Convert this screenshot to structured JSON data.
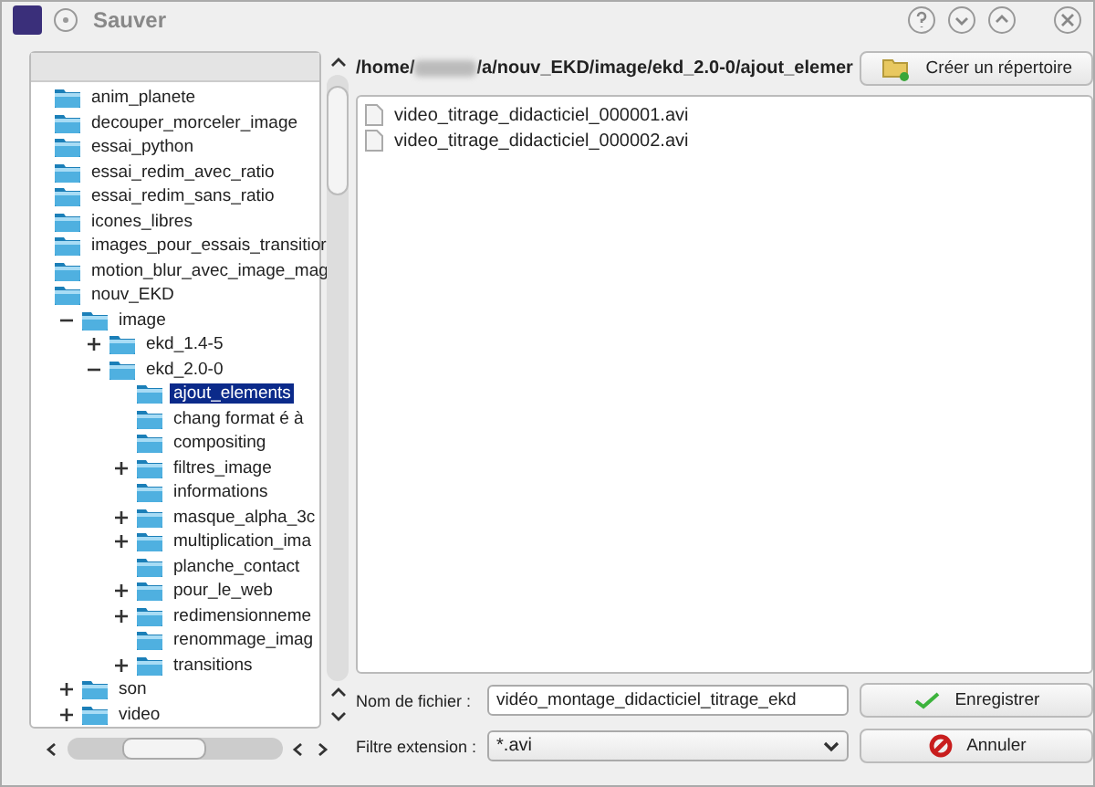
{
  "window": {
    "title": "Sauver"
  },
  "path": {
    "start": "/home/",
    "end": "/a/nouv_EKD/image/ekd_2.0-0/ajout_elemer"
  },
  "create_folder_button": "Créer un répertoire",
  "tree": [
    {
      "label": "anim_planete",
      "selected": false
    },
    {
      "label": "decouper_morceler_image",
      "selected": false
    },
    {
      "label": "essai_python",
      "selected": false
    },
    {
      "label": "essai_redim_avec_ratio",
      "selected": false
    },
    {
      "label": "essai_redim_sans_ratio",
      "selected": false
    },
    {
      "label": "icones_libres",
      "selected": false
    },
    {
      "label": "images_pour_essais_transitior",
      "selected": false
    },
    {
      "label": "motion_blur_avec_image_mag",
      "selected": false
    },
    {
      "label": "nouv_EKD",
      "selected": false,
      "children": [
        {
          "label": "image",
          "selected": false,
          "expanded": true,
          "children": [
            {
              "label": "ekd_1.4-5",
              "selected": false,
              "expanded": false
            },
            {
              "label": "ekd_2.0-0",
              "selected": false,
              "expanded": true,
              "children": [
                {
                  "label": "ajout_elements",
                  "selected": true
                },
                {
                  "label": "chang format é à",
                  "selected": false
                },
                {
                  "label": "compositing",
                  "selected": false
                },
                {
                  "label": "filtres_image",
                  "selected": false,
                  "expanded": false
                },
                {
                  "label": "informations",
                  "selected": false
                },
                {
                  "label": "masque_alpha_3c",
                  "selected": false,
                  "expanded": false
                },
                {
                  "label": "multiplication_ima",
                  "selected": false,
                  "expanded": false
                },
                {
                  "label": "planche_contact",
                  "selected": false
                },
                {
                  "label": "pour_le_web",
                  "selected": false,
                  "expanded": false
                },
                {
                  "label": "redimensionneme",
                  "selected": false,
                  "expanded": false
                },
                {
                  "label": "renommage_imag",
                  "selected": false
                },
                {
                  "label": "transitions",
                  "selected": false,
                  "expanded": false
                }
              ]
            }
          ]
        },
        {
          "label": "son",
          "selected": false,
          "expanded": false
        },
        {
          "label": "video",
          "selected": false,
          "expanded": false
        }
      ]
    }
  ],
  "files": [
    "video_titrage_didacticiel_000001.avi",
    "video_titrage_didacticiel_000002.avi"
  ],
  "filename": {
    "label": "Nom de fichier :",
    "value": "vidéo_montage_didacticiel_titrage_ekd"
  },
  "filter": {
    "label": "Filtre extension :",
    "value": "*.avi"
  },
  "buttons": [
    {
      "kind": "save",
      "label": "Enregistrer"
    },
    {
      "kind": "cancel",
      "label": "Annuler"
    }
  ]
}
